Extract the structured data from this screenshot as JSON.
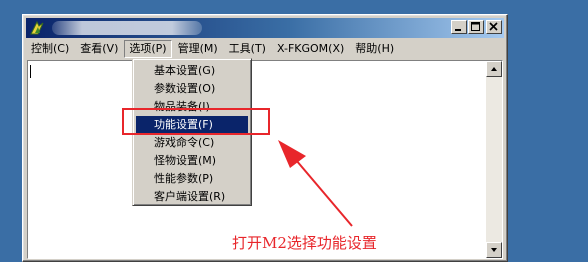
{
  "window": {
    "title": "",
    "caption_buttons": {
      "minimize": "minimize-icon",
      "maximize": "maximize-icon",
      "close": "close-icon"
    }
  },
  "menubar": {
    "items": [
      {
        "label": "控制(C)"
      },
      {
        "label": "查看(V)"
      },
      {
        "label": "选项(P)"
      },
      {
        "label": "管理(M)"
      },
      {
        "label": "工具(T)"
      },
      {
        "label": "X-FKGOM(X)"
      },
      {
        "label": "帮助(H)"
      }
    ],
    "active_index": 2
  },
  "dropdown": {
    "items": [
      {
        "label": "基本设置(G)"
      },
      {
        "label": "参数设置(O)"
      },
      {
        "label": "物品装备(I)"
      },
      {
        "label": "功能设置(F)"
      },
      {
        "label": "游戏命令(C)"
      },
      {
        "label": "怪物设置(M)"
      },
      {
        "label": "性能参数(P)"
      },
      {
        "label": "客户端设置(R)"
      }
    ],
    "selected_index": 3
  },
  "annotation": {
    "text": "打开M2选择功能设置",
    "color": "#e8262b"
  },
  "colors": {
    "desktop": "#3a6ea5",
    "selection": "#0a246a",
    "annotation_red": "#e8262b"
  }
}
